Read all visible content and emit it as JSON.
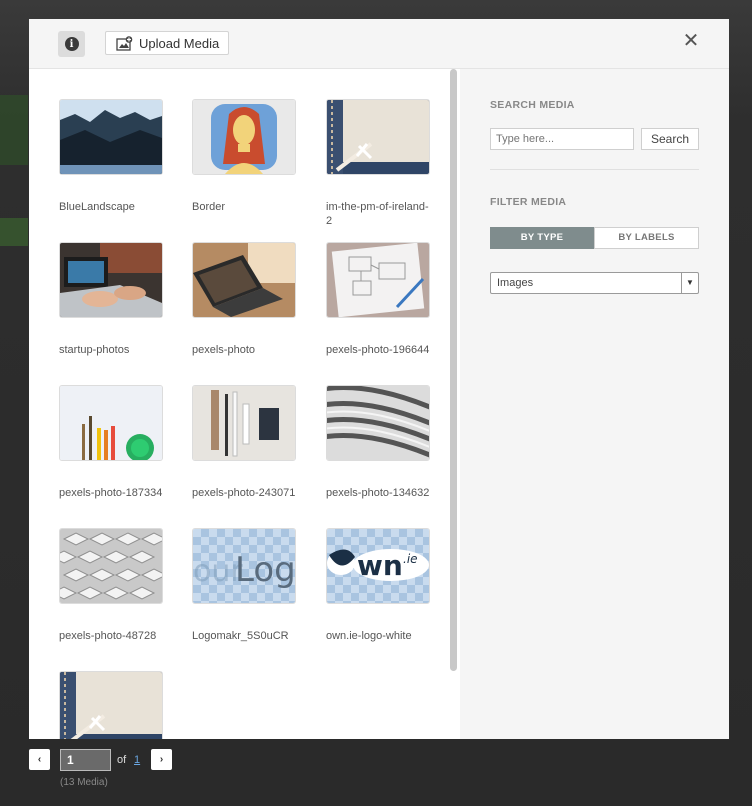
{
  "header": {
    "upload_label": "Upload Media",
    "close_glyph": "✕",
    "info_glyph": "i"
  },
  "media": [
    {
      "name": "BlueLandscape",
      "thumb": "blue-mountains"
    },
    {
      "name": "Border",
      "thumb": "cartoon-portrait"
    },
    {
      "name": "im-the-pm-of-ireland-2",
      "thumb": "denim-envelope"
    },
    {
      "name": "startup-photos",
      "thumb": "laptop-typing"
    },
    {
      "name": "pexels-photo",
      "thumb": "laptop-desk"
    },
    {
      "name": "pexels-photo-196644",
      "thumb": "sketch-notebook"
    },
    {
      "name": "pexels-photo-187334",
      "thumb": "paint-supplies"
    },
    {
      "name": "pexels-photo-243071",
      "thumb": "stationery-flatlay"
    },
    {
      "name": "pexels-photo-134632",
      "thumb": "metal-architecture"
    },
    {
      "name": "pexels-photo-48728",
      "thumb": "geometric-facade"
    },
    {
      "name": "Logomakr_5S0uCR",
      "thumb": "logo-transparent"
    },
    {
      "name": "own.ie-logo-white",
      "thumb": "own-logo"
    },
    {
      "name": "",
      "thumb": "denim-envelope"
    }
  ],
  "sidebar": {
    "search_heading": "SEARCH MEDIA",
    "search_placeholder": "Type here...",
    "search_button": "Search",
    "filter_heading": "FILTER MEDIA",
    "tab_by_type": "BY TYPE",
    "tab_by_labels": "BY LABELS",
    "type_selected": "Images"
  },
  "pager": {
    "prev_glyph": "‹",
    "next_glyph": "›",
    "current_page": "1",
    "of_label": "of",
    "total_pages": "1",
    "count_label": "(13 Media)"
  },
  "logo_text": {
    "logomakr_partial": "our",
    "logomakr_main": "Log",
    "own_main": "wn",
    "own_suffix": ".ie"
  },
  "colors": {
    "active_tab": "#7f8c8d",
    "link": "#6aa6e0"
  }
}
